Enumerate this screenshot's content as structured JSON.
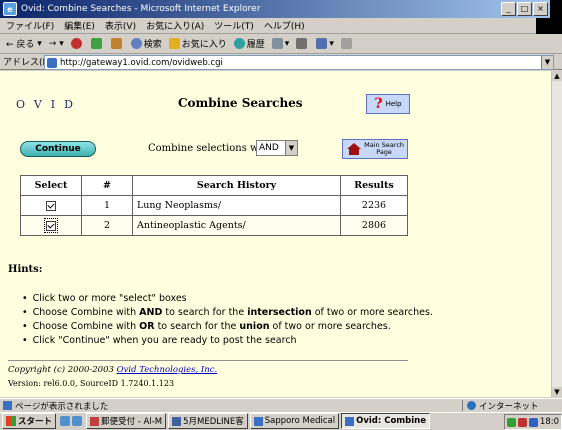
{
  "window": {
    "title": "Ovid: Combine Searches - Microsoft Internet Explorer",
    "controls": [
      "_",
      "□",
      "×"
    ]
  },
  "menu": [
    "ファイル(F)",
    "編集(E)",
    "表示(V)",
    "お気に入り(A)",
    "ツール(T)",
    "ヘルプ(H)"
  ],
  "toolbar": {
    "back": "← 戻る",
    "forward": "→",
    "search": "検索",
    "favorites": "お気に入り",
    "history": "履歴"
  },
  "address": {
    "label": "アドレス(D)",
    "url": "http://gateway1.ovid.com/ovidweb.cgi"
  },
  "page": {
    "logo": "OVID",
    "title": "Combine Searches",
    "help_label": "Help",
    "help_glyph": "?",
    "continue_label": "Continue",
    "combine_label": "Combine selections with:",
    "combine_value": "AND",
    "main_search_label": "Main Search Page",
    "table": {
      "headers": [
        "Select",
        "#",
        "Search History",
        "Results"
      ],
      "rows": [
        {
          "num": "1",
          "query": "Lung Neoplasms/",
          "results": "2236"
        },
        {
          "num": "2",
          "query": "Antineoplastic Agents/",
          "results": "2806"
        }
      ]
    },
    "hints_title": "Hints:",
    "hints": [
      "Click two or more \"select\" boxes",
      "Choose Combine with AND to search for the intersection of two or more searches.",
      "Choose Combine with OR to search for the union of two or more searches.",
      "Click \"Continue\" when you are ready to post the search"
    ],
    "copyright_prefix": "Copyright (c) 2000-2003 ",
    "copyright_link": "Ovid Technologies, Inc.",
    "version": "Version: rel6.0.0, SourceID 1.7240.1.123"
  },
  "status": {
    "text": "ページが表示されました",
    "zone": "インターネット"
  },
  "taskbar": {
    "start": "スタート",
    "tasks": [
      "郵便受付 - Al-M",
      "5月MEDLINE客",
      "Sapporo Medical",
      "Ovid: Combine"
    ],
    "clock": "18:0"
  }
}
